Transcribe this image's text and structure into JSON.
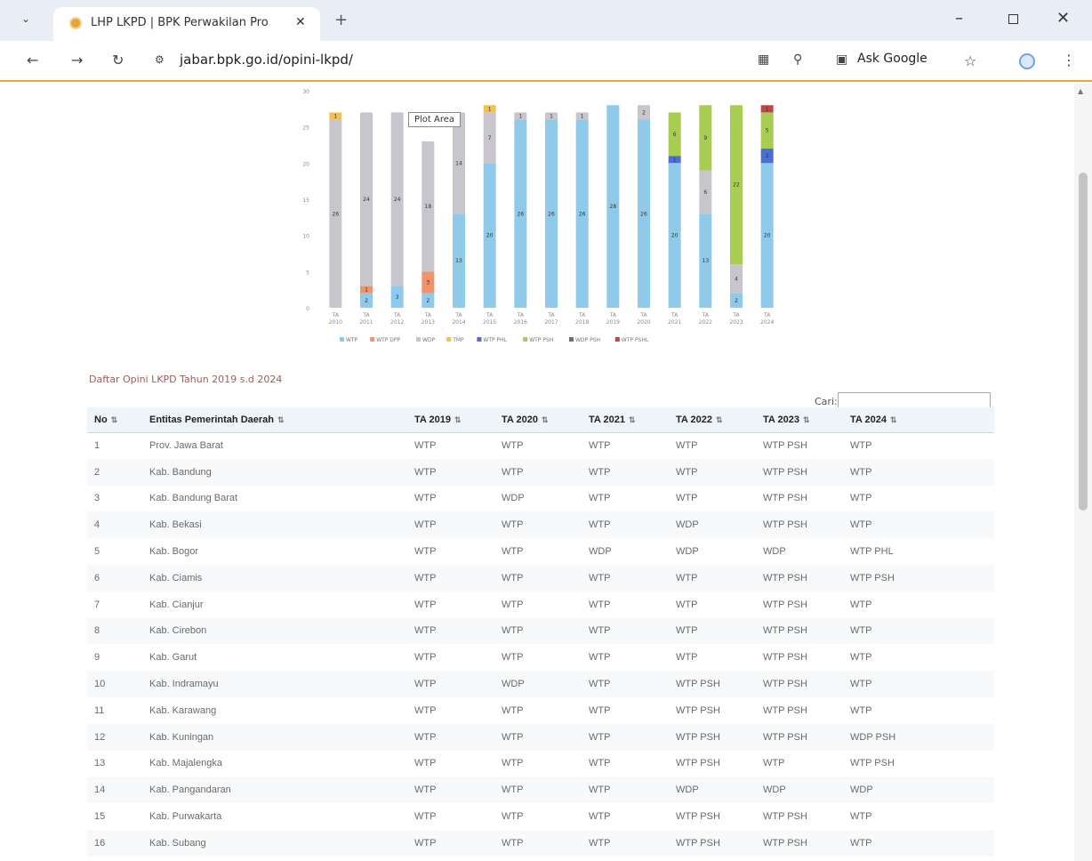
{
  "browser": {
    "tab_title": "LHP LKPD | BPK Perwakilan Pro",
    "url": "jabar.bpk.go.id/opini-lkpd/",
    "ask_google": "Ask Google"
  },
  "icons": {
    "tab_menu": "chevron-down-icon",
    "tab_close": "close-icon",
    "new_tab": "plus-icon",
    "back": "arrow-left-icon",
    "forward": "arrow-right-icon",
    "reload": "reload-icon",
    "site_info": "tune-icon",
    "translate": "translate-icon",
    "zoom": "zoom-icon",
    "lens": "google-lens-icon",
    "bookmark": "star-icon",
    "profile": "profile-icon",
    "menu": "kebab-menu-icon"
  },
  "colors": {
    "WTP": "#8fcaea",
    "WTP_DPP": "#f0926a",
    "WDP": "#c8c6cc",
    "TMP": "#f2c14e",
    "WTP_PHL": "#4a6fd0",
    "WTP_PSH": "#a9cc52",
    "WDP_PSH": "#707070",
    "WTP_PSHL": "#c0454a",
    "accent": "#f1a33c"
  },
  "chart_data": {
    "type": "bar",
    "stacked": true,
    "categories": [
      "TA 2010",
      "TA 2011",
      "TA 2012",
      "TA 2013",
      "TA 2014",
      "TA 2015",
      "TA 2016",
      "TA 2017",
      "TA 2018",
      "TA 2019",
      "TA 2020",
      "TA 2021",
      "TA 2022",
      "TA 2023",
      "TA 2024"
    ],
    "ylim": [
      0,
      30
    ],
    "yticks": [
      0,
      5,
      10,
      15,
      20,
      25,
      30
    ],
    "grid": false,
    "legend_position": "bottom",
    "series": [
      {
        "name": "WTP",
        "color_key": "WTP",
        "values": [
          0,
          2,
          3,
          2,
          13,
          20,
          26,
          26,
          26,
          28,
          26,
          20,
          13,
          2,
          20
        ]
      },
      {
        "name": "WTP DPP",
        "color_key": "WTP_DPP",
        "values": [
          0,
          1,
          0,
          3,
          0,
          0,
          0,
          0,
          0,
          0,
          0,
          0,
          0,
          0,
          0
        ]
      },
      {
        "name": "WDP",
        "color_key": "WDP",
        "values": [
          26,
          24,
          24,
          18,
          14,
          7,
          1,
          1,
          1,
          0,
          2,
          0,
          6,
          4,
          0
        ]
      },
      {
        "name": "TMP",
        "color_key": "TMP",
        "values": [
          1,
          0,
          0,
          0,
          0,
          1,
          0,
          0,
          0,
          0,
          0,
          0,
          0,
          0,
          0
        ]
      },
      {
        "name": "WTP PHL",
        "color_key": "WTP_PHL",
        "values": [
          0,
          0,
          0,
          0,
          0,
          0,
          0,
          0,
          0,
          0,
          0,
          1,
          0,
          0,
          2
        ]
      },
      {
        "name": "WTP PSH",
        "color_key": "WTP_PSH",
        "values": [
          0,
          0,
          0,
          0,
          0,
          0,
          0,
          0,
          0,
          0,
          0,
          6,
          9,
          22,
          5
        ]
      },
      {
        "name": "WDP PSH",
        "color_key": "WDP_PSH",
        "values": [
          0,
          0,
          0,
          0,
          0,
          0,
          0,
          0,
          0,
          0,
          0,
          0,
          0,
          0,
          0
        ]
      },
      {
        "name": "WTP PSHL",
        "color_key": "WTP_PSHL",
        "values": [
          0,
          0,
          0,
          0,
          0,
          0,
          0,
          0,
          0,
          0,
          0,
          0,
          0,
          0,
          1
        ]
      }
    ],
    "tooltip": "Plot Area"
  },
  "section": {
    "title": "Daftar Opini LKPD Tahun 2019 s.d 2024",
    "search_label": "Cari:",
    "search_value": ""
  },
  "table": {
    "headers": [
      "No",
      "Entitas Pemerintah Daerah",
      "TA 2019",
      "TA 2020",
      "TA 2021",
      "TA 2022",
      "TA 2023",
      "TA 2024"
    ],
    "rows": [
      [
        "1",
        "Prov. Jawa Barat",
        "WTP",
        "WTP",
        "WTP",
        "WTP",
        "WTP PSH",
        "WTP"
      ],
      [
        "2",
        "Kab. Bandung",
        "WTP",
        "WTP",
        "WTP",
        "WTP",
        "WTP PSH",
        "WTP"
      ],
      [
        "3",
        "Kab. Bandung Barat",
        "WTP",
        "WDP",
        "WTP",
        "WTP",
        "WTP PSH",
        "WTP"
      ],
      [
        "4",
        "Kab. Bekasi",
        "WTP",
        "WTP",
        "WTP",
        "WDP",
        "WTP PSH",
        "WTP"
      ],
      [
        "5",
        "Kab. Bogor",
        "WTP",
        "WTP",
        "WDP",
        "WDP",
        "WDP",
        "WTP PHL"
      ],
      [
        "6",
        "Kab. Ciamis",
        "WTP",
        "WTP",
        "WTP",
        "WTP",
        "WTP PSH",
        "WTP PSH"
      ],
      [
        "7",
        "Kab. Cianjur",
        "WTP",
        "WTP",
        "WTP",
        "WTP",
        "WTP PSH",
        "WTP"
      ],
      [
        "8",
        "Kab. Cirebon",
        "WTP",
        "WTP",
        "WTP",
        "WTP",
        "WTP PSH",
        "WTP"
      ],
      [
        "9",
        "Kab. Garut",
        "WTP",
        "WTP",
        "WTP",
        "WTP",
        "WTP PSH",
        "WTP"
      ],
      [
        "10",
        "Kab. Indramayu",
        "WTP",
        "WDP",
        "WTP",
        "WTP PSH",
        "WTP PSH",
        "WTP"
      ],
      [
        "11",
        "Kab. Karawang",
        "WTP",
        "WTP",
        "WTP",
        "WTP PSH",
        "WTP PSH",
        "WTP"
      ],
      [
        "12",
        "Kab. Kuningan",
        "WTP",
        "WTP",
        "WTP",
        "WTP PSH",
        "WTP PSH",
        "WDP PSH"
      ],
      [
        "13",
        "Kab. Majalengka",
        "WTP",
        "WTP",
        "WTP",
        "WTP PSH",
        "WTP",
        "WTP PSH"
      ],
      [
        "14",
        "Kab. Pangandaran",
        "WTP",
        "WTP",
        "WTP",
        "WDP",
        "WDP",
        "WDP"
      ],
      [
        "15",
        "Kab. Purwakarta",
        "WTP",
        "WTP",
        "WTP",
        "WTP PSH",
        "WTP PSH",
        "WTP"
      ],
      [
        "16",
        "Kab. Subang",
        "WTP",
        "WTP",
        "WTP",
        "WTP PSH",
        "WTP PSH",
        "WTP"
      ]
    ]
  }
}
